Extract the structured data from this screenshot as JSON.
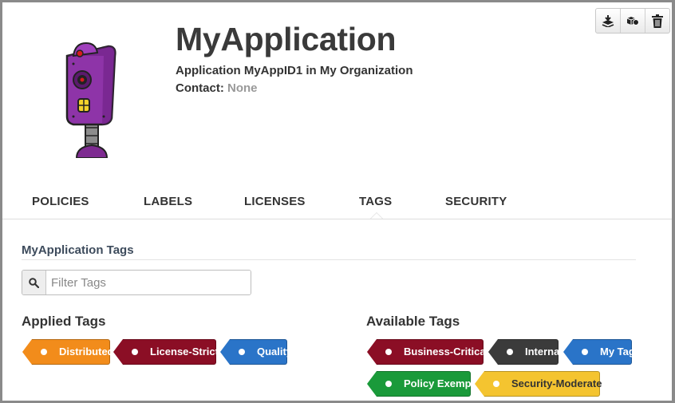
{
  "header": {
    "app_name": "MyApplication",
    "subtitle": "Application MyAppID1 in My Organization",
    "contact_label": "Contact:",
    "contact_value": "None"
  },
  "toolbar": {
    "icons": [
      "layers-icon",
      "cubes-icon",
      "trash-icon"
    ]
  },
  "tabs": [
    {
      "label": "POLICIES"
    },
    {
      "label": "LABELS"
    },
    {
      "label": "LICENSES"
    },
    {
      "label": "TAGS",
      "active": true
    },
    {
      "label": "SECURITY"
    }
  ],
  "tags_section": {
    "title": "MyApplication Tags",
    "filter_placeholder": "Filter Tags",
    "filter_value": "",
    "applied_title": "Applied Tags",
    "available_title": "Available Tags",
    "applied": [
      {
        "label": "Distributed",
        "color": "#f28c1b"
      },
      {
        "label": "License-Strict",
        "color": "#8b0e25"
      },
      {
        "label": "Quality",
        "color": "#2a74c8"
      }
    ],
    "available": [
      {
        "label": "Business-Critical",
        "color": "#8b0e25"
      },
      {
        "label": "Internal",
        "color": "#3b3b3b"
      },
      {
        "label": "My Tag",
        "color": "#2a74c8"
      },
      {
        "label": "Policy Exempt",
        "color": "#1a9a3a"
      },
      {
        "label": "Security-Moderate",
        "color": "#f4c430",
        "text_color": "#333333"
      }
    ]
  }
}
